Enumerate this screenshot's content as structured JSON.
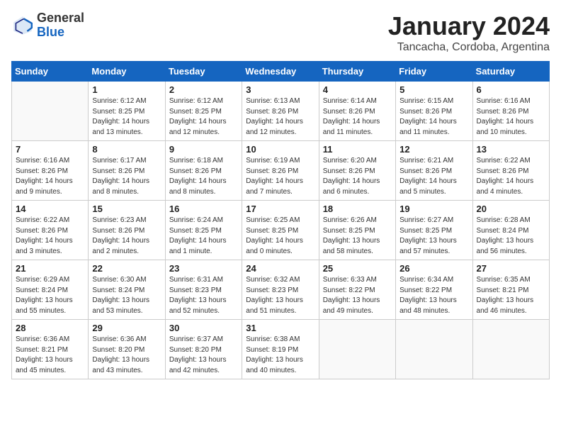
{
  "header": {
    "logo_general": "General",
    "logo_blue": "Blue",
    "month_title": "January 2024",
    "location": "Tancacha, Cordoba, Argentina"
  },
  "days_of_week": [
    "Sunday",
    "Monday",
    "Tuesday",
    "Wednesday",
    "Thursday",
    "Friday",
    "Saturday"
  ],
  "weeks": [
    [
      {
        "day": "",
        "empty": true
      },
      {
        "day": "1",
        "sunrise": "6:12 AM",
        "sunset": "8:25 PM",
        "daylight": "14 hours and 13 minutes."
      },
      {
        "day": "2",
        "sunrise": "6:12 AM",
        "sunset": "8:25 PM",
        "daylight": "14 hours and 12 minutes."
      },
      {
        "day": "3",
        "sunrise": "6:13 AM",
        "sunset": "8:26 PM",
        "daylight": "14 hours and 12 minutes."
      },
      {
        "day": "4",
        "sunrise": "6:14 AM",
        "sunset": "8:26 PM",
        "daylight": "14 hours and 11 minutes."
      },
      {
        "day": "5",
        "sunrise": "6:15 AM",
        "sunset": "8:26 PM",
        "daylight": "14 hours and 11 minutes."
      },
      {
        "day": "6",
        "sunrise": "6:16 AM",
        "sunset": "8:26 PM",
        "daylight": "14 hours and 10 minutes."
      }
    ],
    [
      {
        "day": "7",
        "sunrise": "6:16 AM",
        "sunset": "8:26 PM",
        "daylight": "14 hours and 9 minutes."
      },
      {
        "day": "8",
        "sunrise": "6:17 AM",
        "sunset": "8:26 PM",
        "daylight": "14 hours and 8 minutes."
      },
      {
        "day": "9",
        "sunrise": "6:18 AM",
        "sunset": "8:26 PM",
        "daylight": "14 hours and 8 minutes."
      },
      {
        "day": "10",
        "sunrise": "6:19 AM",
        "sunset": "8:26 PM",
        "daylight": "14 hours and 7 minutes."
      },
      {
        "day": "11",
        "sunrise": "6:20 AM",
        "sunset": "8:26 PM",
        "daylight": "14 hours and 6 minutes."
      },
      {
        "day": "12",
        "sunrise": "6:21 AM",
        "sunset": "8:26 PM",
        "daylight": "14 hours and 5 minutes."
      },
      {
        "day": "13",
        "sunrise": "6:22 AM",
        "sunset": "8:26 PM",
        "daylight": "14 hours and 4 minutes."
      }
    ],
    [
      {
        "day": "14",
        "sunrise": "6:22 AM",
        "sunset": "8:26 PM",
        "daylight": "14 hours and 3 minutes."
      },
      {
        "day": "15",
        "sunrise": "6:23 AM",
        "sunset": "8:26 PM",
        "daylight": "14 hours and 2 minutes."
      },
      {
        "day": "16",
        "sunrise": "6:24 AM",
        "sunset": "8:25 PM",
        "daylight": "14 hours and 1 minute."
      },
      {
        "day": "17",
        "sunrise": "6:25 AM",
        "sunset": "8:25 PM",
        "daylight": "14 hours and 0 minutes."
      },
      {
        "day": "18",
        "sunrise": "6:26 AM",
        "sunset": "8:25 PM",
        "daylight": "13 hours and 58 minutes."
      },
      {
        "day": "19",
        "sunrise": "6:27 AM",
        "sunset": "8:25 PM",
        "daylight": "13 hours and 57 minutes."
      },
      {
        "day": "20",
        "sunrise": "6:28 AM",
        "sunset": "8:24 PM",
        "daylight": "13 hours and 56 minutes."
      }
    ],
    [
      {
        "day": "21",
        "sunrise": "6:29 AM",
        "sunset": "8:24 PM",
        "daylight": "13 hours and 55 minutes."
      },
      {
        "day": "22",
        "sunrise": "6:30 AM",
        "sunset": "8:24 PM",
        "daylight": "13 hours and 53 minutes."
      },
      {
        "day": "23",
        "sunrise": "6:31 AM",
        "sunset": "8:23 PM",
        "daylight": "13 hours and 52 minutes."
      },
      {
        "day": "24",
        "sunrise": "6:32 AM",
        "sunset": "8:23 PM",
        "daylight": "13 hours and 51 minutes."
      },
      {
        "day": "25",
        "sunrise": "6:33 AM",
        "sunset": "8:22 PM",
        "daylight": "13 hours and 49 minutes."
      },
      {
        "day": "26",
        "sunrise": "6:34 AM",
        "sunset": "8:22 PM",
        "daylight": "13 hours and 48 minutes."
      },
      {
        "day": "27",
        "sunrise": "6:35 AM",
        "sunset": "8:21 PM",
        "daylight": "13 hours and 46 minutes."
      }
    ],
    [
      {
        "day": "28",
        "sunrise": "6:36 AM",
        "sunset": "8:21 PM",
        "daylight": "13 hours and 45 minutes."
      },
      {
        "day": "29",
        "sunrise": "6:36 AM",
        "sunset": "8:20 PM",
        "daylight": "13 hours and 43 minutes."
      },
      {
        "day": "30",
        "sunrise": "6:37 AM",
        "sunset": "8:20 PM",
        "daylight": "13 hours and 42 minutes."
      },
      {
        "day": "31",
        "sunrise": "6:38 AM",
        "sunset": "8:19 PM",
        "daylight": "13 hours and 40 minutes."
      },
      {
        "day": "",
        "empty": true
      },
      {
        "day": "",
        "empty": true
      },
      {
        "day": "",
        "empty": true
      }
    ]
  ]
}
